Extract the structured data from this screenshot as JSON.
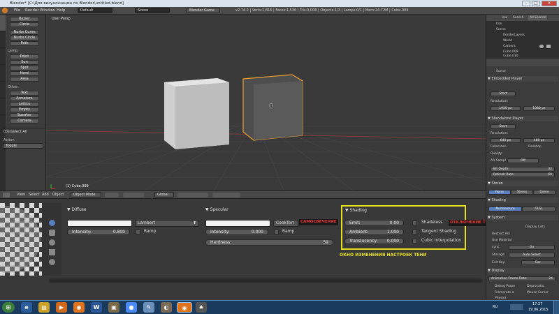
{
  "window": {
    "title": "Blender* [C:\\Для визуализации по Blender\\untitled.blend]",
    "minimize": "–",
    "maximize": "□",
    "close": "×"
  },
  "menu": {
    "items": [
      "File",
      "Render",
      "Window",
      "Help"
    ],
    "layout": "Default",
    "scene": "Scene",
    "engine": "Blender Game",
    "info": "v2.74.2 | Verts:1,816 | Faces:1,536 | Tris:3,008 | Objects:1/3 | Lamps:0/1 | Mem:24.72M | Cube.009"
  },
  "toolshelf": {
    "mesh_tools": [
      "Bezier",
      "Circle",
      "Nurbs Curve",
      "Nurbs Circle",
      "Path"
    ],
    "lamp_label": "Lamp:",
    "lamp_tools": [
      "Point",
      "Sun",
      "Spot",
      "Hemi",
      "Area"
    ],
    "other_label": "Other:",
    "other_tools": [
      "Text",
      "Armature",
      "Lattice",
      "Empty",
      "Speaker",
      "Camera"
    ],
    "operator_title": "(De)select All",
    "action_label": "Action",
    "action_value": "Toggle"
  },
  "viewport": {
    "label": "User Persp",
    "object_label": "(1) Cube.009"
  },
  "vp_header": {
    "view": "View",
    "select": "Select",
    "add": "Add",
    "object": "Object",
    "mode": "Object Mode",
    "orientation": "Global"
  },
  "diffuse": {
    "title": "Diffuse",
    "shader": "Lambert",
    "intensity_label": "Intensity:",
    "intensity": "0.800",
    "ramp": "Ramp"
  },
  "specular": {
    "title": "Specular",
    "shader": "CookTorr",
    "intensity_label": "Intensity:",
    "intensity": "0.000",
    "ramp": "Ramp",
    "hardness_label": "Hardness:",
    "hardness": "59"
  },
  "shading": {
    "title": "Shading",
    "emit_label": "Emit:",
    "emit": "0.00",
    "ambient_label": "Ambient:",
    "ambient": "1.000",
    "translucency_label": "Translucency:",
    "translucency": "0.000",
    "shadeless": "Shadeless",
    "tangent": "Tangent Shading",
    "cubic": "Cubic Interpolation"
  },
  "annotations": {
    "self_glow": "САМОСВЕЧЕНИЕ",
    "no_shadows": "ОТКЛЮЧЕНИЕ ТЕНЕЙ",
    "shadow_window": "ОКНО ИЗМЕНЕНИЯ НАСТРОЕК ТЕНИ",
    "highlight_color": "#e8e01c"
  },
  "outliner": {
    "tabs": [
      "iew",
      "Search",
      "All Scenes"
    ],
    "items": [
      "hon",
      "Scene",
      "RenderLayers",
      "World",
      "Camera",
      "Cube.009",
      "Cube.010"
    ]
  },
  "rpanel": {
    "scene": "Scene",
    "embedded_title": "Embedded Player",
    "start1": "Start",
    "resolution1": "Resolution:",
    "res_x1": "1920 px",
    "res_y1": "1080 px",
    "standalone_title": "Standalone Player",
    "start2": "Start",
    "resolution2": "Resolution:",
    "res_x2": "640 px",
    "res_y2": "480 px",
    "fullscreen": "Fullscreen",
    "desktop": "Desktop",
    "quality": "Quality:",
    "aa": "AA Sampl",
    "aa_value": "Off",
    "bit_depth_label": "Bit Depth:",
    "bit_depth": "32",
    "refresh_label": "Refresh Rate:",
    "refresh": "60",
    "stereo_title": "Stereo",
    "stereo_opts": [
      "None",
      "Stereo",
      "Dome"
    ],
    "shading_title": "Shading",
    "shading_opts": [
      "Multitexture",
      "GLSL"
    ],
    "system_title": "System",
    "display_lists": "Display Lists",
    "restrict": "Restrict Ani",
    "use_material": "Use Material",
    "sync_label": "sync:",
    "sync_value": "On",
    "storage_label": "Storage:",
    "storage_value": "Auto Select",
    "exit_label": "Exit Key:",
    "exit_value": "Esc",
    "display_title": "Display",
    "frame_rate_label": "Animation Frame Rate:",
    "frame_rate": "24",
    "debug": "Debug Prope",
    "deprecation": "Deprecatio",
    "framerate": "Framerate a",
    "mouse_cursor": "Mouse Cursor",
    "physics": "Physics"
  },
  "taskbar": {
    "lang": "RU",
    "time": "17:27",
    "date": "19.06.2015",
    "icons": [
      "start",
      "ie",
      "explorer",
      "media",
      "blender",
      "word",
      "files",
      "chrome",
      "paint",
      "gimp",
      "blender2",
      "games"
    ]
  }
}
